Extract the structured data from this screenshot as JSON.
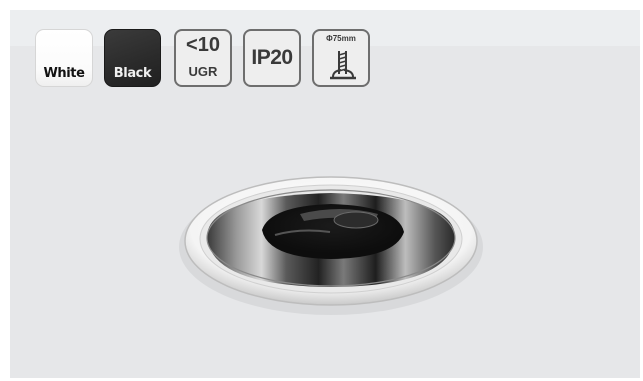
{
  "swatches": [
    {
      "label": "White",
      "color": "#ffffff"
    },
    {
      "label": "Black",
      "color": "#2b2b2b"
    }
  ],
  "specs": {
    "ugr_value": "<10",
    "ugr_label": "UGR",
    "ip_rating": "IP20",
    "cutout": "Φ75mm",
    "cutout_icon": "ceiling-cutout-icon"
  },
  "product_image": {
    "icon": "downlight-image"
  }
}
